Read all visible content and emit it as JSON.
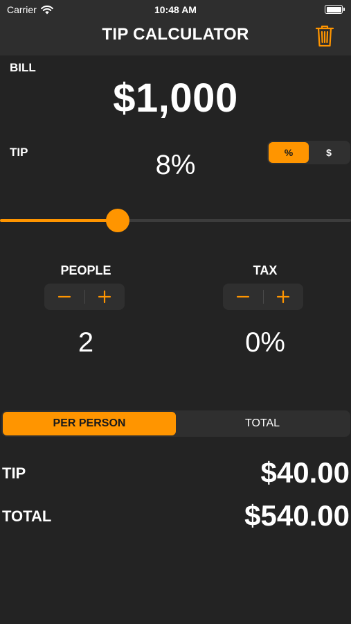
{
  "status": {
    "carrier": "Carrier",
    "time": "10:48 AM",
    "wifi_icon": "wifi-icon",
    "battery_icon": "battery-icon"
  },
  "header": {
    "title": "TIP CALCULATOR",
    "trash_icon": "trash-icon"
  },
  "bill": {
    "label": "BILL",
    "amount": "$1,000"
  },
  "tip": {
    "label": "TIP",
    "value": "8%",
    "mode_options": [
      "%",
      "$"
    ],
    "mode_selected": "%",
    "slider_fraction": 0.335
  },
  "people": {
    "label": "PEOPLE",
    "value": "2",
    "minus_icon": "minus-icon",
    "plus_icon": "plus-icon"
  },
  "tax": {
    "label": "TAX",
    "value": "0%",
    "minus_icon": "minus-icon",
    "plus_icon": "plus-icon"
  },
  "view": {
    "options": [
      "PER PERSON",
      "TOTAL"
    ],
    "selected": "PER PERSON"
  },
  "results": {
    "tip_label": "TIP",
    "tip_value": "$40.00",
    "total_label": "TOTAL",
    "total_value": "$540.00"
  },
  "colors": {
    "accent": "#ff9500",
    "background": "#232323",
    "bar": "#2e2e2e"
  }
}
